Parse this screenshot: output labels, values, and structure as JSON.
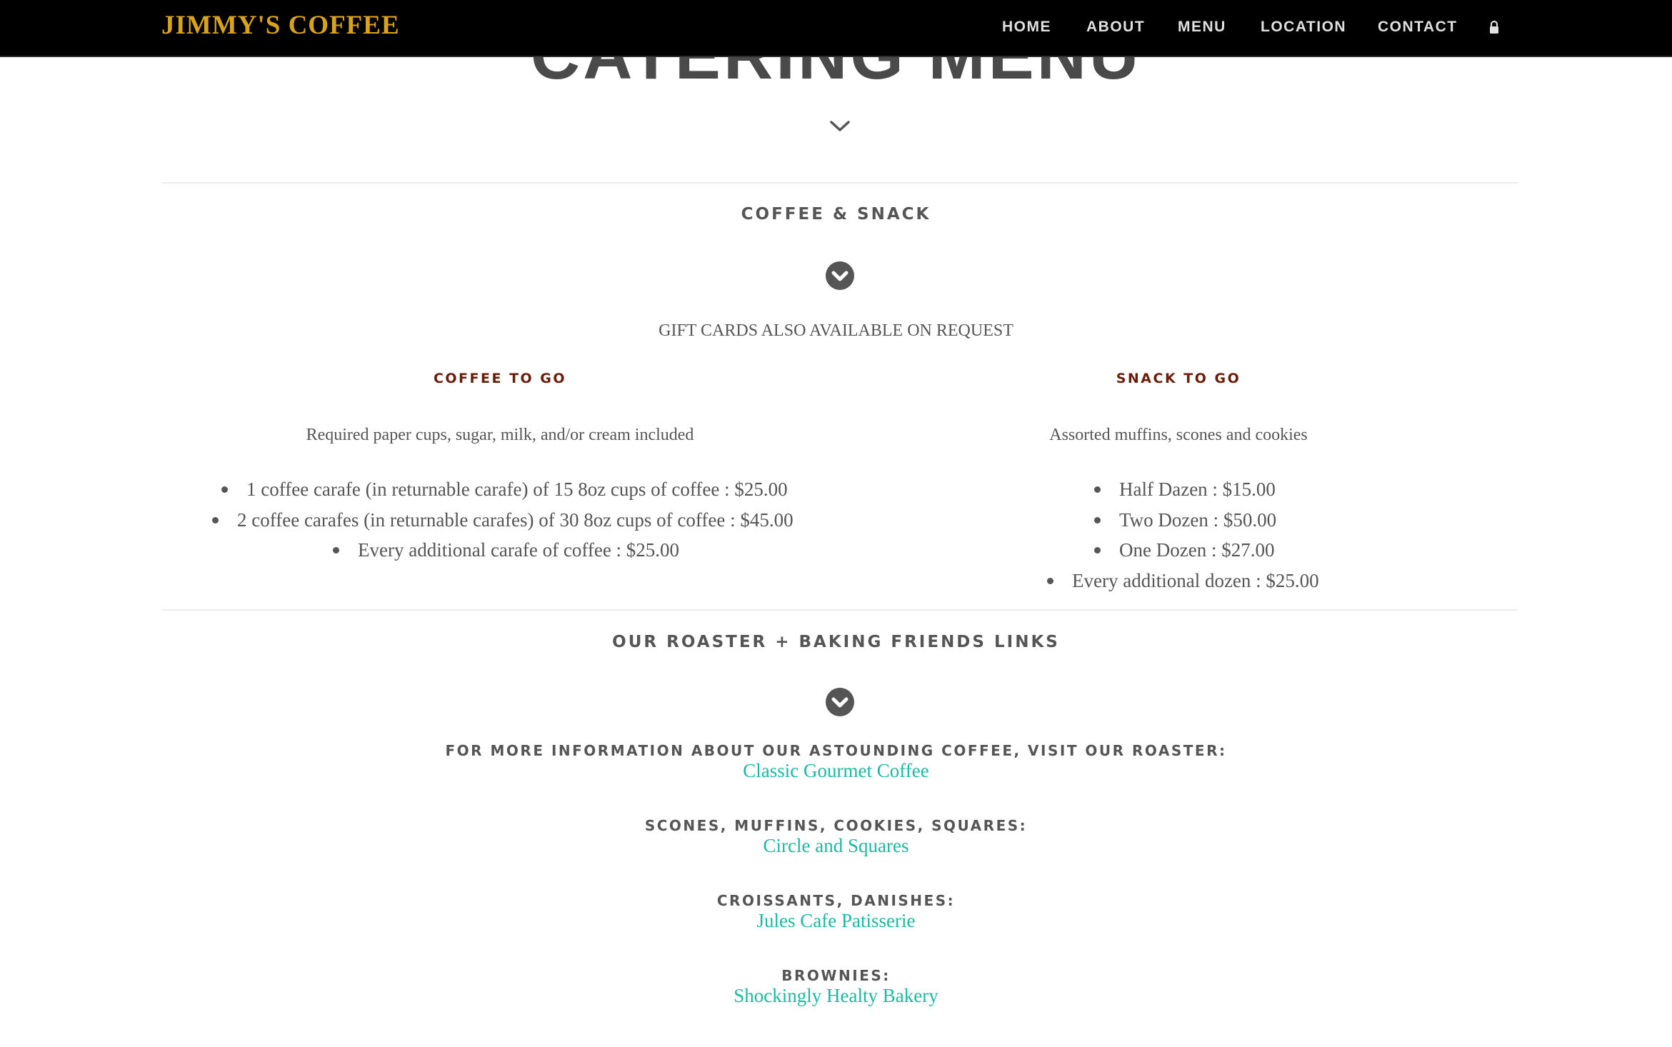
{
  "partial_title": "CATERING MENU",
  "nav": {
    "brand": "JIMMY'S COFFEE",
    "items": [
      "HOME",
      "ABOUT",
      "MENU",
      "LOCATION",
      "CONTACT"
    ]
  },
  "coffee_snack": {
    "heading": "COFFEE & SNACK",
    "gift_note": "GIFT CARDS ALSO AVAILABLE ON REQUEST",
    "coffee": {
      "heading": "COFFEE TO GO",
      "note": "Required paper cups, sugar, milk, and/or cream included",
      "items": [
        "1 coffee carafe (in returnable carafe) of 15 8oz cups of coffee : $25.00",
        "2 coffee carafes (in returnable carafes) of 30 8oz cups of coffee : $45.00",
        "Every additional carafe of coffee : $25.00"
      ]
    },
    "snack": {
      "heading": "SNACK TO GO",
      "note": "Assorted muffins, scones and cookies",
      "items": [
        "Half Dazen : $15.00",
        "Two Dozen : $50.00",
        "One Dozen : $27.00",
        "Every additional dozen : $25.00"
      ]
    }
  },
  "links_section": {
    "heading": "OUR ROASTER + BAKING FRIENDS LINKS",
    "entries": [
      {
        "label": "FOR MORE INFORMATION ABOUT OUR ASTOUNDING COFFEE, VISIT OUR ROASTER:",
        "link": "Classic Gourmet Coffee"
      },
      {
        "label": "SCONES, MUFFINS, COOKIES, SQUARES:",
        "link": "Circle and Squares"
      },
      {
        "label": "CROISSANTS, DANISHES:",
        "link": "Jules Cafe Patisserie"
      },
      {
        "label": "BROWNIES:",
        "link": "Shockingly Healty Bakery"
      }
    ]
  },
  "colors": {
    "brand": "#d9a31a",
    "nav_bg": "#000000",
    "subheading": "#6b1d0a",
    "link": "#1ab9a0",
    "text": "#555555"
  }
}
